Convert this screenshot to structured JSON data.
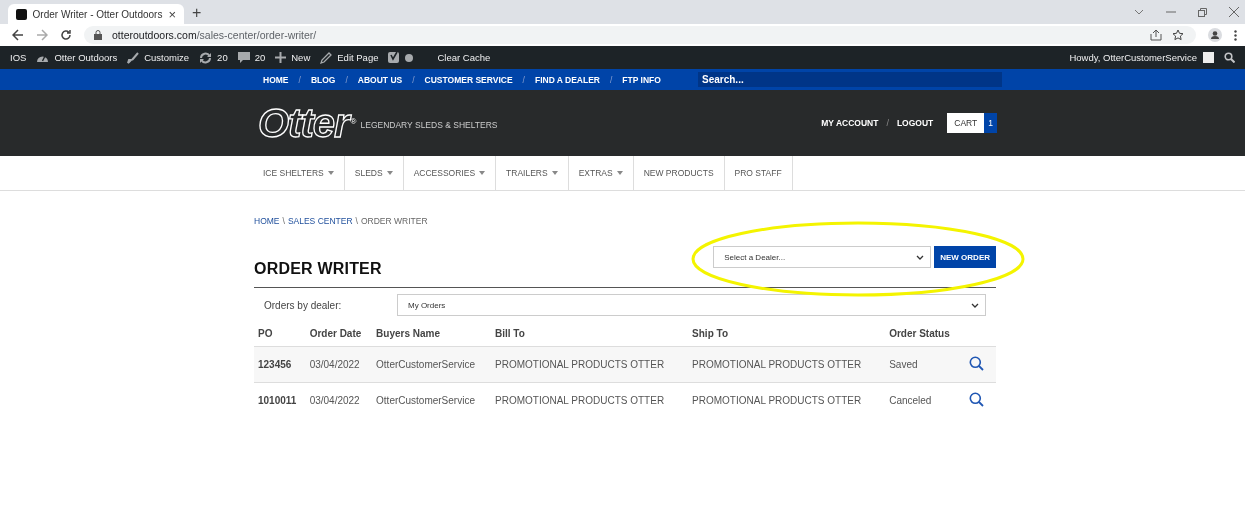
{
  "browser": {
    "tab_title": "Order Writer - Otter Outdoors",
    "tab_close": "×",
    "new_tab": "+",
    "url_host": "otteroutdoors.com",
    "url_path": "/sales-center/order-writer/"
  },
  "admin_bar": {
    "items": [
      {
        "kind": "text",
        "label": "IOS"
      },
      {
        "kind": "gauge",
        "label": "Otter Outdoors"
      },
      {
        "kind": "brush",
        "label": "Customize"
      },
      {
        "kind": "refresh",
        "label": "20"
      },
      {
        "kind": "comment",
        "label": "20"
      },
      {
        "kind": "plus",
        "label": "New"
      },
      {
        "kind": "pencil",
        "label": "Edit Page"
      },
      {
        "kind": "seo"
      },
      {
        "kind": "text",
        "label": "Clear Cache"
      }
    ],
    "greeting": "Howdy, OtterCustomerService"
  },
  "top_nav": {
    "links": [
      "HOME",
      "BLOG",
      "ABOUT US",
      "CUSTOMER SERVICE",
      "FIND A DEALER",
      "FTP INFO"
    ],
    "separator": "/",
    "search_placeholder": "Search..."
  },
  "header": {
    "logo": "Otter",
    "registered": "®",
    "tagline": "LEGENDARY SLEDS & SHELTERS",
    "account": "MY ACCOUNT",
    "separator": "/",
    "logout": "LOGOUT",
    "cart": "CART",
    "cart_count": "1"
  },
  "categories": [
    {
      "label": "ICE SHELTERS",
      "dropdown": true
    },
    {
      "label": "SLEDS",
      "dropdown": true
    },
    {
      "label": "ACCESSORIES",
      "dropdown": true
    },
    {
      "label": "TRAILERS",
      "dropdown": true
    },
    {
      "label": "EXTRAS",
      "dropdown": true
    },
    {
      "label": "NEW PRODUCTS",
      "dropdown": false
    },
    {
      "label": "PRO STAFF",
      "dropdown": false
    }
  ],
  "breadcrumb": [
    {
      "label": "HOME",
      "link": true
    },
    {
      "label": "SALES CENTER",
      "link": true
    },
    {
      "label": "ORDER WRITER",
      "link": false
    }
  ],
  "breadcrumb_separator": "\\",
  "dealer_select": {
    "placeholder": "Select a Dealer..."
  },
  "new_order_button": "NEW ORDER",
  "title": "ORDER WRITER",
  "filter": {
    "label": "Orders by dealer:",
    "value": "My Orders"
  },
  "table": {
    "columns": [
      "PO",
      "Order Date",
      "Buyers Name",
      "Bill To",
      "Ship To",
      "Order Status"
    ],
    "rows": [
      {
        "po": "123456",
        "date": "03/04/2022",
        "buyer": "OtterCustomerService",
        "bill_to": "PROMOTIONAL PRODUCTS OTTER",
        "ship_to": "PROMOTIONAL PRODUCTS OTTER",
        "status": "Saved"
      },
      {
        "po": "1010011",
        "date": "03/04/2022",
        "buyer": "OtterCustomerService",
        "bill_to": "PROMOTIONAL PRODUCTS OTTER",
        "ship_to": "PROMOTIONAL PRODUCTS OTTER",
        "status": "Canceled"
      }
    ]
  }
}
